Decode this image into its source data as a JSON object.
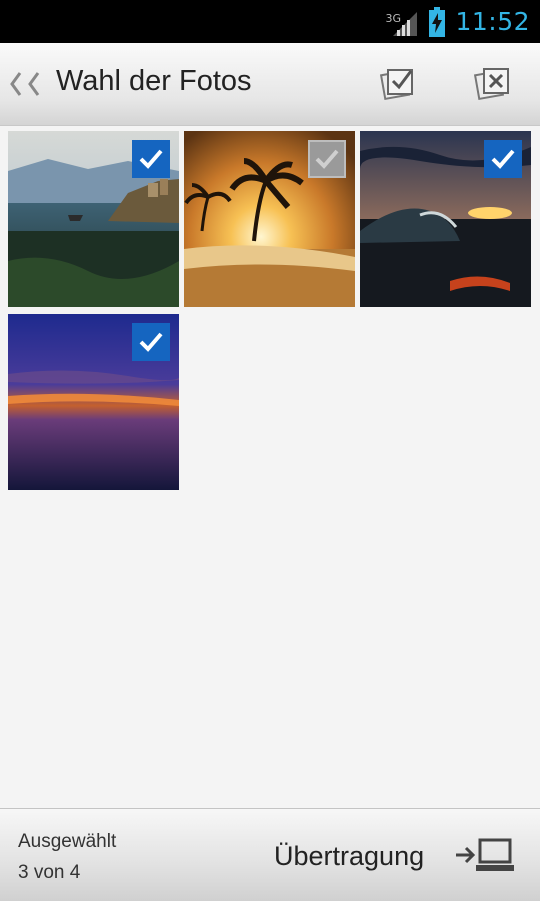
{
  "status": {
    "network": "3G",
    "time": "11:52"
  },
  "actionbar": {
    "title": "Wahl der Fotos",
    "select_all_icon": "stack-check-icon",
    "deselect_all_icon": "stack-x-icon"
  },
  "photos": [
    {
      "scene": "coast-town",
      "checked": true
    },
    {
      "scene": "palm-sunset",
      "checked": false
    },
    {
      "scene": "wave-sunset",
      "checked": true
    },
    {
      "scene": "purple-horizon",
      "checked": true
    }
  ],
  "footer": {
    "selected_label": "Ausgewählt",
    "selected_count": "3 von 4",
    "transfer_label": "Übertragung",
    "transfer_icon": "arrow-to-computer-icon"
  },
  "colors": {
    "accent": "#33b5e5",
    "check_blue": "#1565c0",
    "check_grey": "#8a8a8a"
  }
}
